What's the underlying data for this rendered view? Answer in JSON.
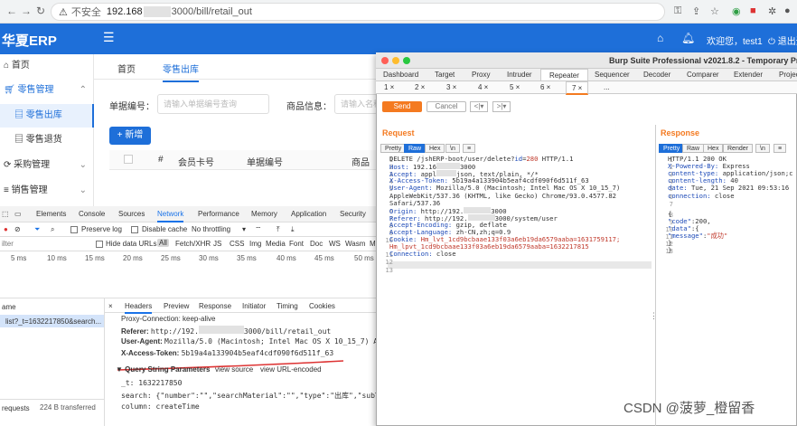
{
  "browser": {
    "insecure_label": "不安全",
    "url_host": "192.168",
    "url_path": "3000/bill/retail_out"
  },
  "erp": {
    "logo": "华夏ERP",
    "welcome": "欢迎您，test1",
    "logout": "退出登",
    "sidebar": {
      "home": "首页",
      "retail_mgmt": "零售管理",
      "retail_out": "零售出库",
      "retail_return": "零售退货",
      "purchase_mgmt": "采购管理",
      "sales_mgmt": "销售管理"
    },
    "tabs": {
      "home": "首页",
      "retail_out": "零售出库"
    },
    "form": {
      "bill_no_label": "单据编号：",
      "bill_no_placeholder": "请输入单据编号查询",
      "goods_label": "商品信息：",
      "goods_placeholder": "请输入名称"
    },
    "add_button": "+ 新增",
    "table_headers": {
      "index": "#",
      "member_card": "会员卡号",
      "bill_no": "单据编号",
      "goods": "商品"
    }
  },
  "devtools": {
    "tabs": [
      "Elements",
      "Console",
      "Sources",
      "Network",
      "Performance",
      "Memory",
      "Application",
      "Security"
    ],
    "toolbar": {
      "preserve_log": "Preserve log",
      "disable_cache": "Disable cache",
      "throttling": "No throttling"
    },
    "filter": {
      "placeholder": "ilter",
      "hide_data_urls": "Hide data URLs",
      "types": [
        "All",
        "Fetch/XHR",
        "JS",
        "CSS",
        "Img",
        "Media",
        "Font",
        "Doc",
        "WS",
        "Wasm",
        "M"
      ]
    },
    "timeline_ticks": [
      "5 ms",
      "10 ms",
      "15 ms",
      "20 ms",
      "25 ms",
      "30 ms",
      "35 ms",
      "40 ms",
      "45 ms",
      "50 ms"
    ],
    "request_list": {
      "name_header": "ame",
      "item": "list?_t=1632217850&search...",
      "footer_requests": "requests",
      "footer_transfer": "224 B transferred"
    },
    "detail_tabs": [
      "Headers",
      "Preview",
      "Response",
      "Initiator",
      "Timing",
      "Cookies"
    ],
    "headers": {
      "proxy_connection": "Proxy-Connection: keep-alive",
      "referer_key": "Referer:",
      "referer_val": "http://192.",
      "referer_tail": "3000/bill/retail_out",
      "ua_key": "User-Agent:",
      "ua_val": "Mozilla/5.0 (Macintosh; Intel Mac OS X 10_15_7) App",
      "token_key": "X-Access-Token:",
      "token_val": "5b19a4a133904b5eaf4cdf090f6d511f_63",
      "qsp_title": "▼ Query String Parameters",
      "view_source": "view source",
      "view_url_encoded": "view URL-encoded",
      "t_line": "_t: 1632217850",
      "search_line": "search: {\"number\":\"\",\"searchMaterial\":\"\",\"type\":\"出库\",\"subType",
      "column_line": "column: createTime"
    }
  },
  "burp": {
    "title": "Burp Suite Professional v2021.8.2 - Temporary Proje",
    "tabs": [
      "Dashboard",
      "Target",
      "Proxy",
      "Intruder",
      "Repeater",
      "Sequencer",
      "Decoder",
      "Comparer",
      "Extender",
      "Projec"
    ],
    "subtabs": [
      "1 ×",
      "2 ×",
      "3 ×",
      "4 ×",
      "5 ×",
      "6 ×",
      "7 ×",
      "..."
    ],
    "send": "Send",
    "cancel": "Cancel",
    "request_title": "Request",
    "response_title": "Response",
    "view_buttons": [
      "Pretty",
      "Raw",
      "Hex",
      "\\n",
      "≡"
    ],
    "response_view_buttons": [
      "Pretty",
      "Raw",
      "Hex",
      "Render",
      "\\n",
      "≡"
    ],
    "request_lines": [
      "DELETE /jshERP-boot/user/delete?id=280 HTTP/1.1",
      "Host: 192.16",
      "Accept: appl",
      "X-Access-Token: 5b19a4a133904b5eaf4cdf090f6d511f_63",
      "User-Agent: Mozilla/5.0 (Macintosh; Intel Mac OS X 10_15_7)",
      "AppleWebKit/537.36 (KHTML, like Gecko) Chrome/93.0.4577.82",
      "Safari/537.36",
      "Origin: http://192.",
      "Referer: http://192.",
      "Accept-Encoding: gzip, deflate",
      "Accept-Language: zh-CN,zh;q=0.9",
      "Cookie: Hm_lvt_1cd9bcbaae133f03a6eb19da6579aaba=1631759117;",
      "Hm_lpvt_1cd9bcbaae133f03a6eb19da6579aaba=1632217815",
      "Connection: close",
      "",
      ""
    ],
    "request_suffixes": {
      "host": "3000",
      "accept": "json, text/plain, */*",
      "origin": "3000",
      "referer": "3000/system/user"
    },
    "response_lines": [
      "HTTP/1.1 200 OK",
      "X-Powered-By: Express",
      "content-type: application/json;c",
      "content-length: 40",
      "date: Tue, 21 Sep 2021 09:53:16",
      "connection: close",
      "",
      "{",
      "  \"code\":200,",
      "  \"data\":{",
      "    \"message\":\"成功\"",
      "  }",
      "}"
    ]
  },
  "watermark": "CSDN @菠萝_橙留香"
}
